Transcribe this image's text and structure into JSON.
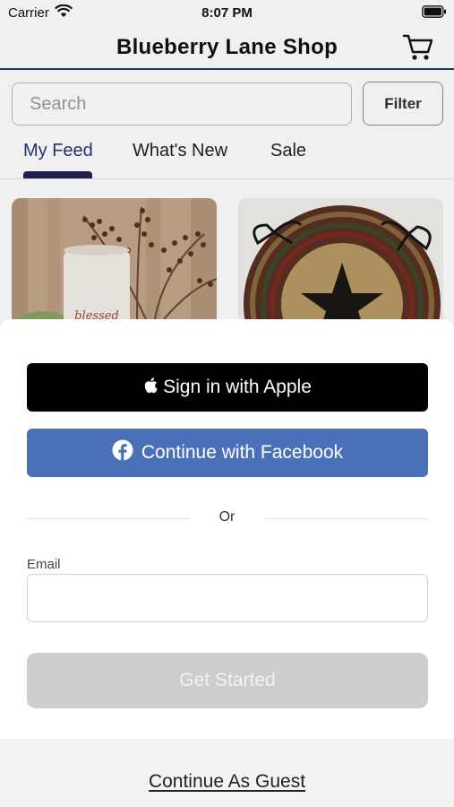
{
  "status_bar": {
    "carrier": "Carrier",
    "time": "8:07 PM"
  },
  "nav": {
    "title": "Blueberry Lane Shop",
    "cart_icon": "cart-icon"
  },
  "search": {
    "placeholder": "Search"
  },
  "filter": {
    "label": "Filter"
  },
  "tabs": [
    {
      "label": "My Feed",
      "active": true
    },
    {
      "label": "What's New",
      "active": false
    },
    {
      "label": "Sale",
      "active": false
    }
  ],
  "products": [
    {
      "image": "blessed candle with berry stems"
    },
    {
      "image": "braided chair pad with star"
    }
  ],
  "sheet": {
    "apple_label": "Sign in with Apple",
    "facebook_label": "Continue with Facebook",
    "or_label": "Or",
    "email_label": "Email",
    "email_value": "",
    "get_started_label": "Get Started",
    "guest_label": "Continue As Guest"
  },
  "colors": {
    "accent": "#2b3674",
    "facebook": "#4a71b8",
    "apple": "#000000",
    "disabled_button": "#cdcdcd"
  }
}
